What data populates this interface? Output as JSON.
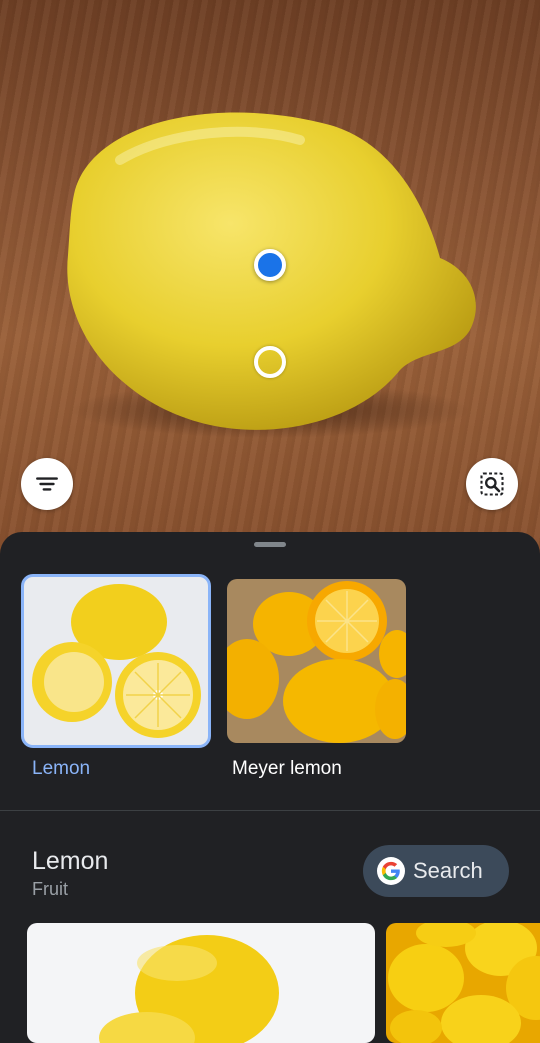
{
  "controls": {
    "filter_icon": "filter-icon",
    "lens_icon": "lens-search-icon",
    "colors": {
      "accent": "#1a73e8",
      "selected_border": "#8ab4f8"
    }
  },
  "results": {
    "thumbnails": [
      {
        "label": "Lemon",
        "selected": true
      },
      {
        "label": "Meyer lemon",
        "selected": false
      }
    ],
    "entity": {
      "title": "Lemon",
      "subtitle": "Fruit",
      "search_label": "Search"
    }
  }
}
